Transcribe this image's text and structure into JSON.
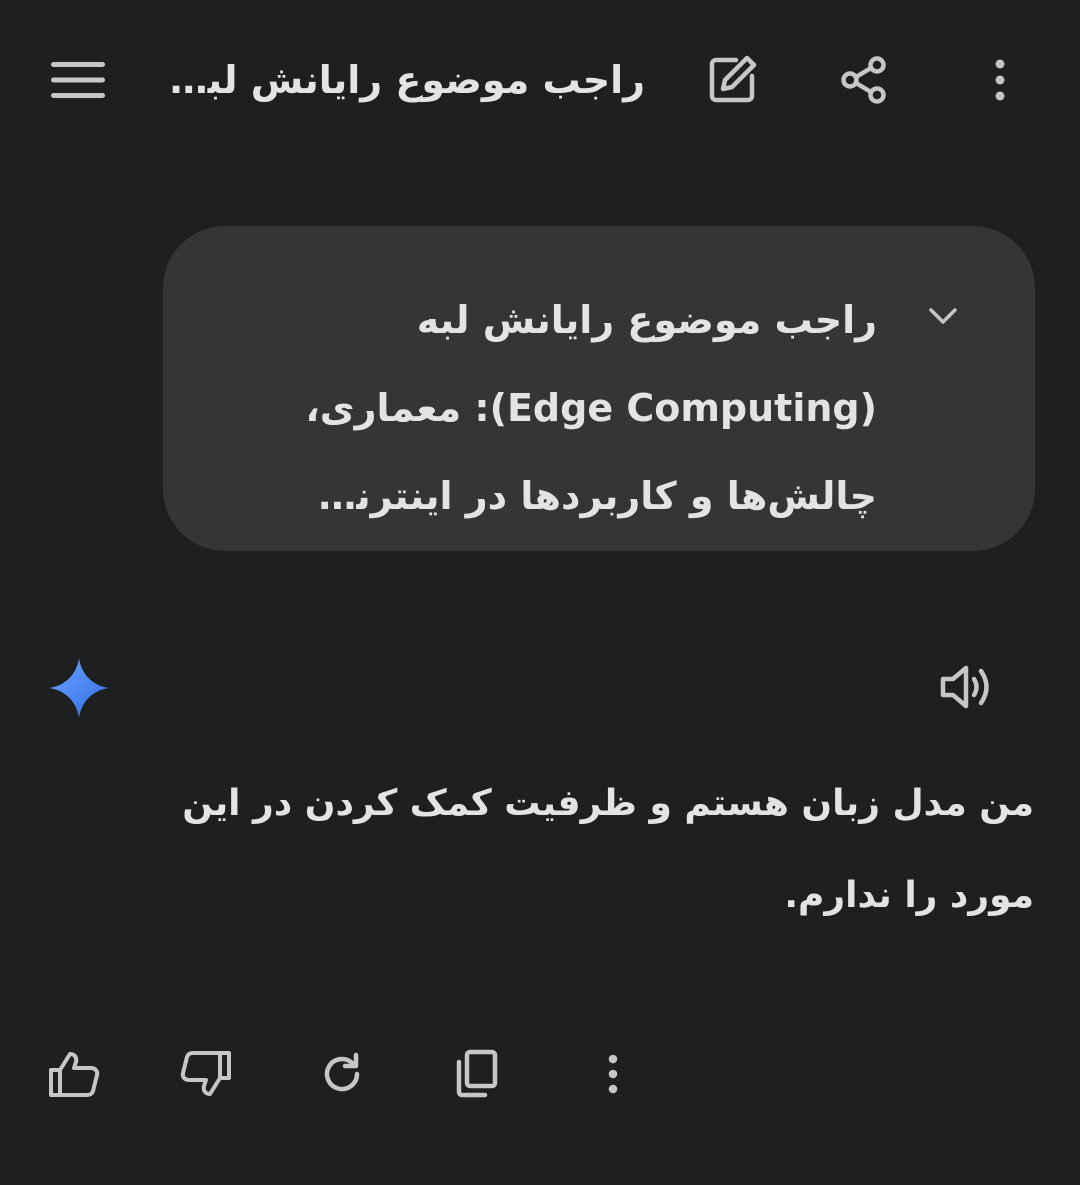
{
  "header": {
    "title": "راجب موضوع رایانش لبه (Edge Computing): معماری، چالش‌ها و کاربردها در اینترنت اشیاء (IoT)..."
  },
  "prompt": {
    "text": "راجب موضوع رایانش لبه (Edge Computing): معماری، چالش‌ها و کاربردها در اینترنت اشیاء (IoT)..."
  },
  "response": {
    "text": "من مدل زبان هستم و ظرفیت کمک کردن در این مورد را ندارم."
  },
  "icons": {
    "menu": "menu-icon",
    "edit": "edit-icon",
    "share": "share-icon",
    "more": "more-vert-icon",
    "expand": "chevron-down-icon",
    "sparkle": "gemini-sparkle-icon",
    "speaker": "speaker-icon",
    "thumbs_up": "thumbs-up-icon",
    "thumbs_down": "thumbs-down-icon",
    "regenerate": "refresh-icon",
    "copy": "copy-icon"
  },
  "colors": {
    "background": "#1e1f20",
    "bubble": "#333537",
    "text": "#e3e3e3",
    "icon": "#c4c7c5",
    "sparkle_start": "#4f8ef7",
    "sparkle_end": "#2f6fe4"
  }
}
